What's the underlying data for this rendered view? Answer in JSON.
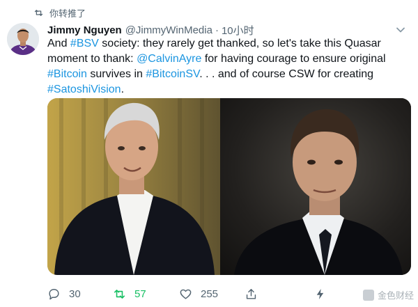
{
  "retweet_context": {
    "icon": "retweet-icon",
    "label": "你转推了"
  },
  "author": {
    "display_name": "Jimmy Nguyen",
    "handle": "@JimmyWinMedia",
    "separator": "·",
    "time": "10小时"
  },
  "tweet": {
    "segments": [
      {
        "text": "And ",
        "link": false
      },
      {
        "text": "#BSV",
        "link": true
      },
      {
        "text": " society:  they rarely get thanked, so let's take this Quasar moment to thank:  ",
        "link": false
      },
      {
        "text": "@CalvinAyre",
        "link": true
      },
      {
        "text": " for having courage to ensure original ",
        "link": false
      },
      {
        "text": "#Bitcoin",
        "link": true
      },
      {
        "text": " survives in ",
        "link": false
      },
      {
        "text": "#BitcoinSV",
        "link": true
      },
      {
        "text": ". . . and of course CSW for creating ",
        "link": false
      },
      {
        "text": "#SatoshiVision",
        "link": true
      },
      {
        "text": ".",
        "link": false
      }
    ]
  },
  "actions": {
    "reply": {
      "icon": "reply-icon",
      "count": "30"
    },
    "retweet": {
      "icon": "retweet-icon",
      "count": "57"
    },
    "like": {
      "icon": "heart-icon",
      "count": "255"
    },
    "share": {
      "icon": "share-icon"
    },
    "analytics": {
      "icon": "lightning-icon"
    }
  },
  "watermark": {
    "text": "金色财经"
  },
  "colors": {
    "link": "#1b95e0",
    "retweet_active": "#17bf63",
    "secondary_text": "#536471"
  }
}
